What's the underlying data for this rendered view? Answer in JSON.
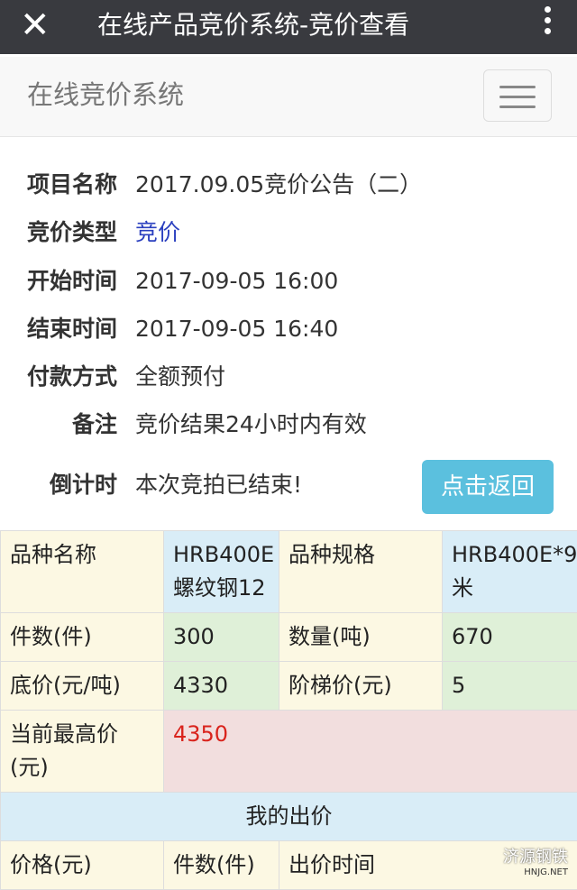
{
  "topbar": {
    "close_icon": "close-icon",
    "title": "在线产品竞价系统-竞价查看",
    "more_icon": "more-vertical-icon"
  },
  "navbar": {
    "brand": "在线竞价系统",
    "menu_icon": "hamburger-icon"
  },
  "info": {
    "project_label": "项目名称",
    "project_value": "2017.09.05竞价公告（二）",
    "type_label": "竞价类型",
    "type_value": "竞价",
    "start_label": "开始时间",
    "start_value": "2017-09-05 16:00",
    "end_label": "结束时间",
    "end_value": "2017-09-05 16:40",
    "pay_label": "付款方式",
    "pay_value": "全额预付",
    "note_label": "备注",
    "note_value": "竞价结果24小时内有效",
    "countdown_label": "倒计时",
    "countdown_value": "本次竞拍已结束!",
    "back_button": "点击返回"
  },
  "table": {
    "variety_label": "品种名称",
    "variety_value": "HRB400E螺纹钢12",
    "spec_label": "品种规格",
    "spec_value": "HRB400E*9米",
    "pieces_label": "件数(件)",
    "pieces_value": "300",
    "qty_label": "数量(吨)",
    "qty_value": "670",
    "base_label": "底价(元/吨)",
    "base_value": "4330",
    "step_label": "阶梯价(元)",
    "step_value": "5",
    "highest_label": "当前最高价(元)",
    "highest_value": "4350",
    "my_bid_title": "我的出价",
    "col_price": "价格(元)",
    "col_pieces": "件数(件)",
    "col_time": "出价时间"
  },
  "watermark": {
    "text": "济源钢铁",
    "sub": "HNJG.NET"
  },
  "colors": {
    "topbar": "#393a3f",
    "button": "#5bc0de",
    "link": "#2a3fbf",
    "highest": "#d9231c"
  }
}
